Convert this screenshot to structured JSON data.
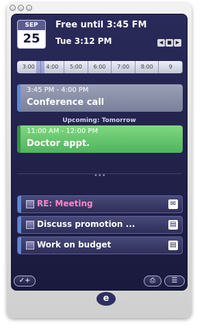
{
  "window": {
    "controls": [
      "close",
      "minimize",
      "zoom"
    ]
  },
  "header": {
    "month": "SEP",
    "day": "25",
    "free_until": "Free until 3:45 FM",
    "now_time": "Tue 3:12 PM",
    "nav": [
      "◀",
      "■",
      "▶"
    ]
  },
  "timeline": {
    "ticks": [
      "3:00",
      "4:00",
      "5:00",
      "6:00",
      "7:00",
      "8:00",
      "9"
    ]
  },
  "events": [
    {
      "time": "3:45 PM - 4:00 PM",
      "title": "Conference call"
    },
    {
      "time": "11:00 AM - 12:00 PM",
      "title": "Doctor appt."
    }
  ],
  "upcoming_label": "Upcoming: Tomorrow",
  "tasks": [
    {
      "label": "RE: Meeting",
      "icon": "mail-icon"
    },
    {
      "label": "Discuss promotion ...",
      "icon": "clipboard-icon"
    },
    {
      "label": "Work on budget",
      "icon": "clipboard-icon"
    }
  ],
  "footer": {
    "add_label": "✓+",
    "print_label": "⎙",
    "list_label": "☰"
  },
  "logo": "e"
}
